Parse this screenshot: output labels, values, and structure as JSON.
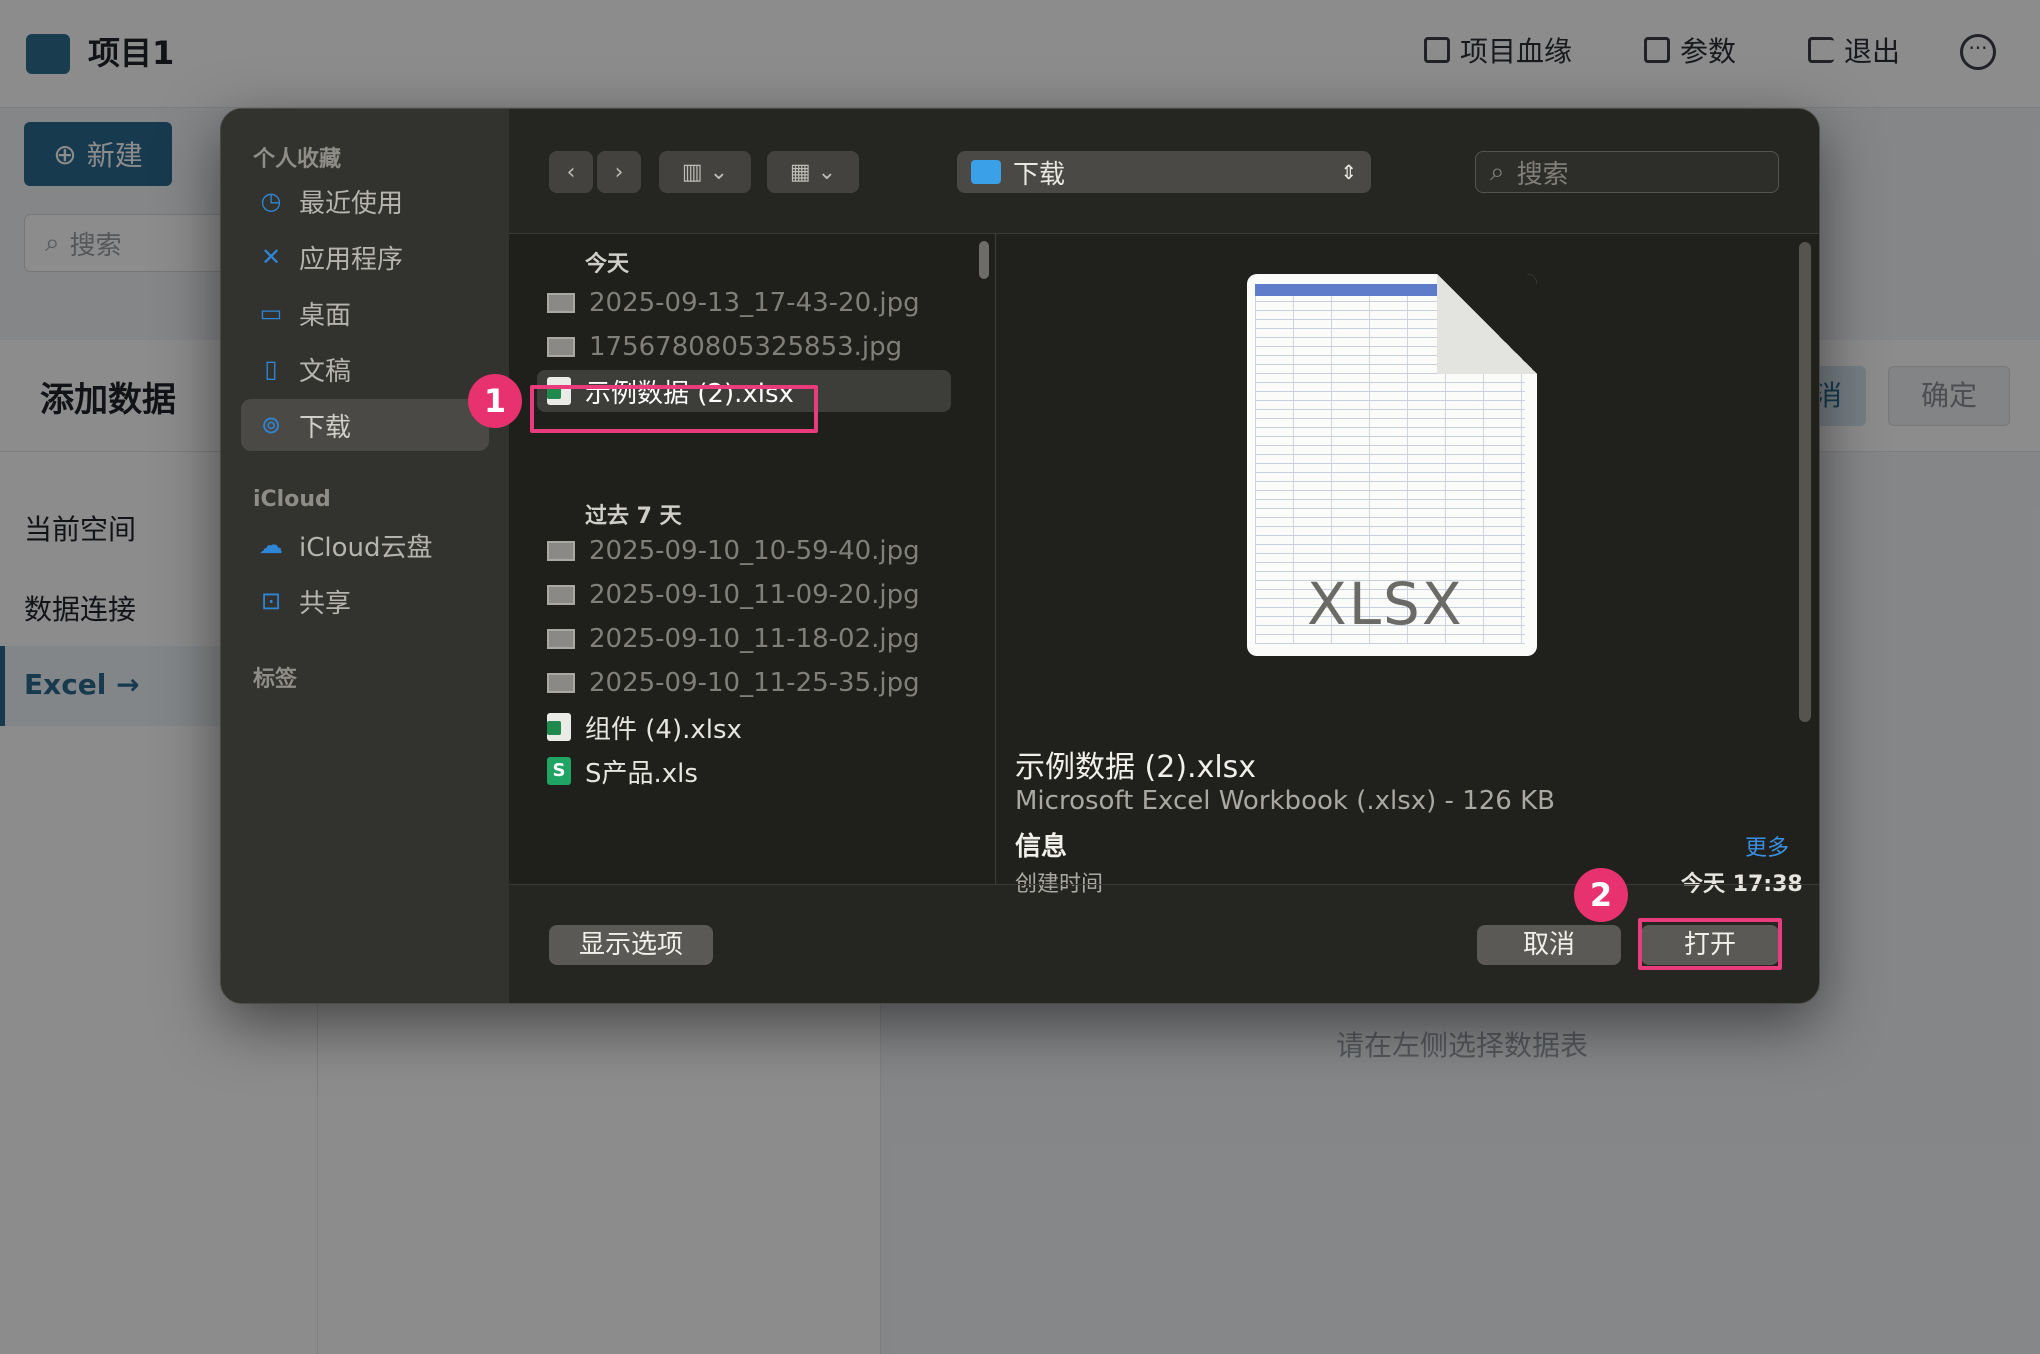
{
  "app": {
    "title": "项目1",
    "header_buttons": [
      {
        "label": "项目血缘",
        "icon": "lineage-icon"
      },
      {
        "label": "参数",
        "icon": "params-icon"
      },
      {
        "label": "退出",
        "icon": "logout-icon"
      }
    ],
    "new_button": "新建",
    "search_placeholder": "搜索",
    "add_data_title": "添加数据",
    "nav": [
      "当前空间",
      "数据连接",
      "Excel"
    ],
    "cancel_label": "消",
    "confirm_label": "确定",
    "hint": "请在左侧选择数据表"
  },
  "dialog": {
    "sidebar": {
      "favorites_title": "个人收藏",
      "favorites": [
        {
          "label": "最近使用",
          "icon": "clock-icon"
        },
        {
          "label": "应用程序",
          "icon": "apps-icon"
        },
        {
          "label": "桌面",
          "icon": "desktop-icon"
        },
        {
          "label": "文稿",
          "icon": "document-icon"
        },
        {
          "label": "下载",
          "icon": "download-icon"
        }
      ],
      "icloud_title": "iCloud",
      "icloud": [
        {
          "label": "iCloud云盘",
          "icon": "cloud-icon"
        },
        {
          "label": "共享",
          "icon": "shared-folder-icon"
        }
      ],
      "tags_title": "标签"
    },
    "toolbar": {
      "location": "下载",
      "search_placeholder": "搜索"
    },
    "groups": [
      {
        "title": "今天",
        "files": [
          {
            "name": "2025-09-13_17-43-20.jpg",
            "type": "image"
          },
          {
            "name": "1756780805325853.jpg",
            "type": "image"
          },
          {
            "name": "示例数据 (2).xlsx",
            "type": "xlsx",
            "selected": true
          }
        ]
      },
      {
        "title": "过去 7 天",
        "files": [
          {
            "name": "2025-09-10_10-59-40.jpg",
            "type": "image"
          },
          {
            "name": "2025-09-10_11-09-20.jpg",
            "type": "image"
          },
          {
            "name": "2025-09-10_11-18-02.jpg",
            "type": "image"
          },
          {
            "name": "2025-09-10_11-25-35.jpg",
            "type": "image"
          },
          {
            "name": "组件 (4).xlsx",
            "type": "xlsx"
          },
          {
            "name": "S产品.xls",
            "type": "xls"
          }
        ]
      }
    ],
    "preview": {
      "badge_label": "XLSX",
      "name": "示例数据 (2).xlsx",
      "type": "Microsoft Excel Workbook (.xlsx) - 126 KB",
      "info_title": "信息",
      "more": "更多",
      "created_label": "创建时间",
      "created_value": "今天 17:38"
    },
    "buttons": {
      "options": "显示选项",
      "cancel": "取消",
      "open": "打开"
    }
  },
  "annotations": {
    "step1": "1",
    "step2": "2",
    "accent": "#e8316f"
  }
}
